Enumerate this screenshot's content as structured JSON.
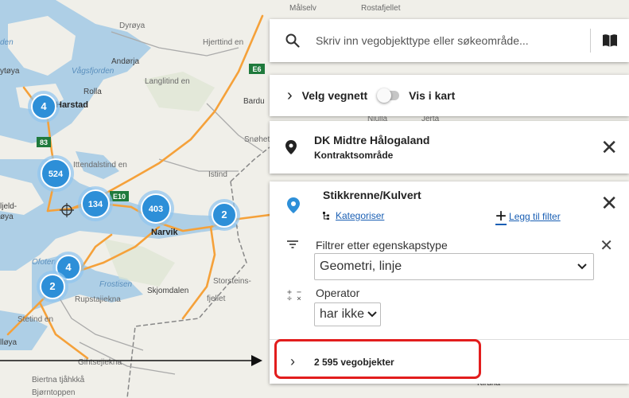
{
  "map": {
    "places": [
      {
        "label": "Dyrøya",
        "cls": "faint"
      },
      {
        "label": "Andørja",
        "cls": ""
      },
      {
        "label": "Vågsfjorden",
        "cls": "water"
      },
      {
        "label": "Rolla",
        "cls": ""
      },
      {
        "label": "Langlitind en",
        "cls": "faint"
      },
      {
        "label": "Harstad",
        "cls": "bold"
      },
      {
        "label": "Hjerttind en",
        "cls": "faint"
      },
      {
        "label": "Bardu",
        "cls": ""
      },
      {
        "label": "Snøhetta",
        "cls": "faint"
      },
      {
        "label": "Istind",
        "cls": "faint"
      },
      {
        "label": "ljeld-",
        "cls": ""
      },
      {
        "label": "øya",
        "cls": ""
      },
      {
        "label": "Narvik",
        "cls": "bold"
      },
      {
        "label": "Ofoten",
        "cls": "water"
      },
      {
        "label": "Frostisen",
        "cls": "water"
      },
      {
        "label": "Skjomdalen",
        "cls": ""
      },
      {
        "label": "Storsteins-",
        "cls": "faint"
      },
      {
        "label": "fjellet",
        "cls": "faint"
      },
      {
        "label": "Rupstajiekna",
        "cls": "faint"
      },
      {
        "label": "Stetind en",
        "cls": "faint"
      },
      {
        "label": "lløya",
        "cls": ""
      },
      {
        "label": "Gihtsejiekna",
        "cls": "faint"
      },
      {
        "label": "Biertna tjåhkkå",
        "cls": "faint"
      },
      {
        "label": "Bjørntoppen",
        "cls": "faint"
      },
      {
        "label": "Målselv",
        "cls": "faint"
      },
      {
        "label": "Rostafjellet",
        "cls": "faint"
      },
      {
        "label": "ytøya",
        "cls": ""
      },
      {
        "label": "den",
        "cls": "water"
      },
      {
        "label": "Njulla",
        "cls": "faint"
      },
      {
        "label": "Jerta",
        "cls": "faint"
      },
      {
        "label": "Kiruna",
        "cls": ""
      },
      {
        "label": "Ittendalstind en",
        "cls": "faint"
      }
    ],
    "road_shields": [
      "E6",
      "E10",
      "83"
    ],
    "clusters": [
      {
        "count": "4"
      },
      {
        "count": "524"
      },
      {
        "count": "134"
      },
      {
        "count": "403"
      },
      {
        "count": "2"
      },
      {
        "count": "4"
      },
      {
        "count": "2"
      }
    ]
  },
  "search": {
    "placeholder": "Skriv inn vegobjekttype eller søkeområde...",
    "icon": "search-icon",
    "book_icon": "book-icon"
  },
  "network": {
    "label": "Velg vegnett",
    "show_in_map": "Vis i kart"
  },
  "contract": {
    "title": "DK Midtre Hålogaland",
    "subtitle": "Kontraktsområde"
  },
  "filter_card": {
    "title": "Stikkrenne/Kulvert",
    "categorize": "Kategoriser",
    "add_filter": "Legg til filter",
    "filter_label": "Filtrer etter egenskapstype",
    "geometry_value": "Geometri, linje",
    "operator_label": "Operator",
    "operator_value": "har ikke"
  },
  "results": {
    "count_label": "2 595 vegobjekter"
  },
  "colors": {
    "accent": "#2d8fd8",
    "link": "#1a5fb4",
    "highlight": "#e21d1d",
    "road": "#f5a13a"
  }
}
